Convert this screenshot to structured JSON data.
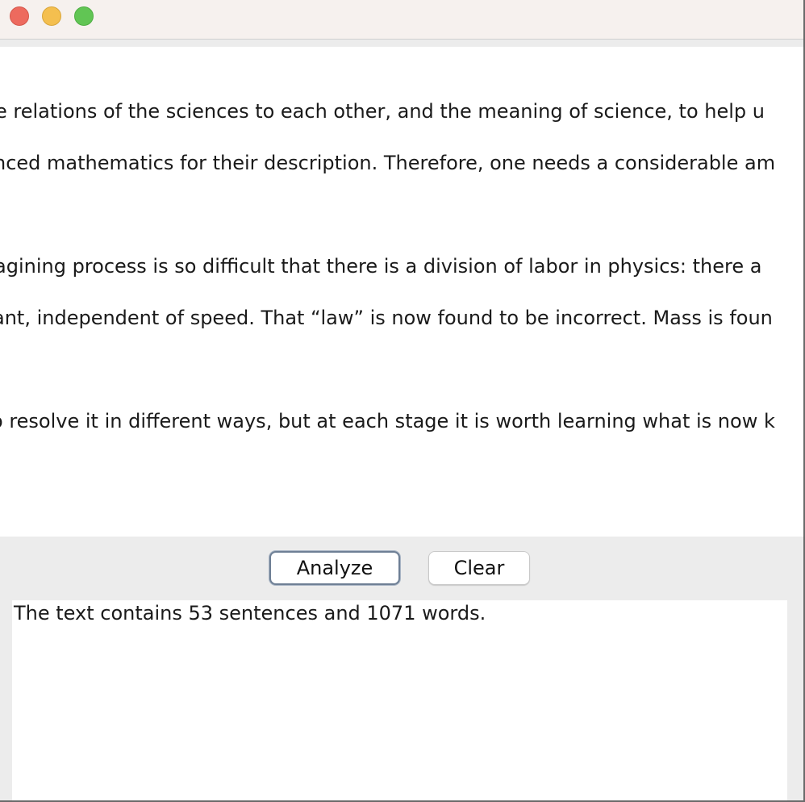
{
  "window": {
    "controls": [
      "close",
      "minimize",
      "maximize"
    ]
  },
  "editor": {
    "lines": [
      "e relations of the sciences to each other, and the meaning of science, to help u",
      "nced mathematics for their description. Therefore, one needs a considerable am",
      "",
      "agining process is so difficult that there is a division of labor in physics: there a",
      "ant, independent of speed. That “law” is now found to be incorrect. Mass is foun",
      "",
      "o resolve it in different ways, but at each stage it is worth learning what is now k"
    ]
  },
  "buttons": {
    "analyze_label": "Analyze",
    "clear_label": "Clear"
  },
  "result": {
    "text": "The text contains 53 sentences and 1071 words."
  }
}
